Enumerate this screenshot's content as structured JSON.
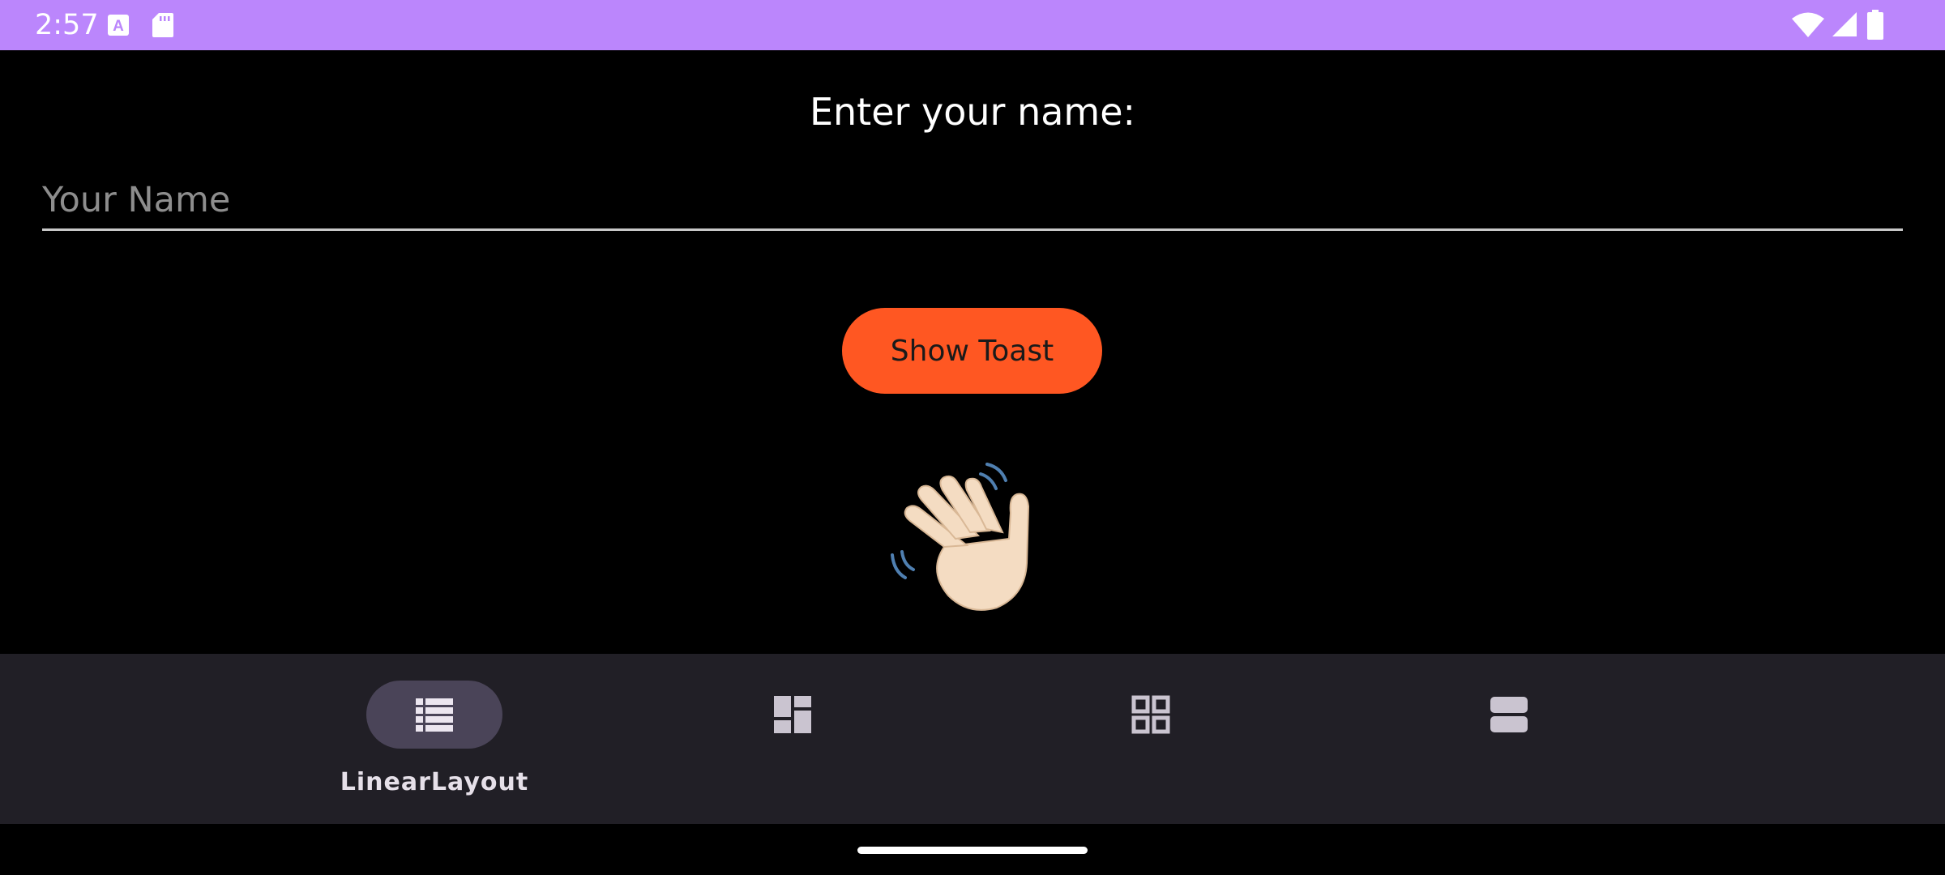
{
  "status_bar": {
    "time": "2:57",
    "background": "#bb86fc",
    "left_icons": [
      "keyboard-a-icon",
      "sd-card-icon"
    ],
    "right_icons": [
      "wifi-icon",
      "signal-icon",
      "battery-icon"
    ]
  },
  "main": {
    "prompt": "Enter your name:",
    "name_input": {
      "value": "",
      "placeholder": "Your Name"
    },
    "toast_button": {
      "label": "Show Toast",
      "color": "#ff5722"
    },
    "image": "waving-hand-icon"
  },
  "bottom_nav": {
    "background": "#211f26",
    "items": [
      {
        "icon": "linear-list-icon",
        "label": "LinearLayout",
        "selected": true
      },
      {
        "icon": "dashboard-icon",
        "label": "",
        "selected": false
      },
      {
        "icon": "grid-icon",
        "label": "",
        "selected": false
      },
      {
        "icon": "stacked-rows-icon",
        "label": "",
        "selected": false
      }
    ]
  }
}
